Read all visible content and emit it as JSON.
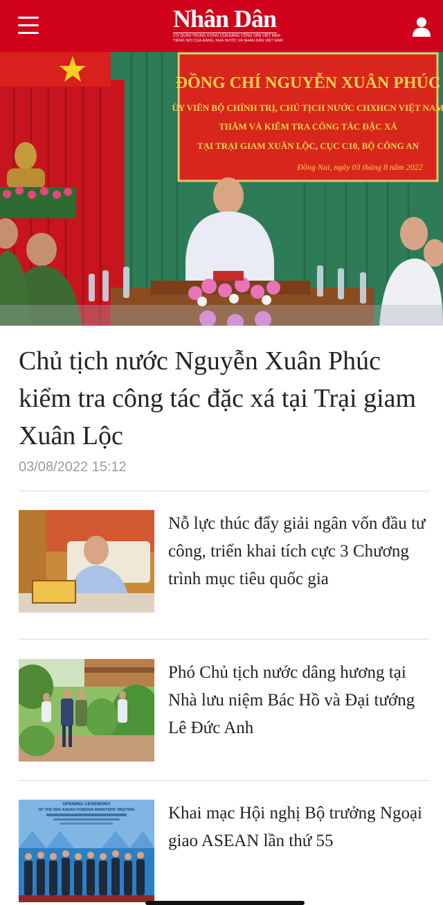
{
  "header": {
    "logo": "Nhân Dân",
    "logo_tagline_1": "CƠ QUAN TRUNG ƯƠNG CỦA ĐẢNG CỘNG SẢN VIỆT NAM",
    "logo_tagline_2": "TIẾNG NÓI CỦA ĐẢNG, NHÀ NƯỚC VÀ NHÂN DÂN VIỆT NAM",
    "menu_icon": "hamburger-menu-icon",
    "user_icon": "user-account-icon"
  },
  "hero": {
    "banner_line_1": "ĐỒNG CHÍ NGUYỄN XUÂN PHÚC",
    "banner_line_2": "ỦY VIÊN BỘ CHÍNH TRỊ, CHỦ TỊCH NƯỚC CHXHCN VIỆT NAM",
    "banner_line_3": "THĂM VÀ KIỂM TRA CÔNG TÁC ĐẶC XÁ",
    "banner_line_4": "TẠI TRẠI GIAM XUÂN LỘC, CỤC C10, BỘ CÔNG AN",
    "banner_date": "Đồng Nai, ngày 03 tháng 8 năm 2022",
    "title": "Chủ tịch nước Nguyễn Xuân Phúc kiểm tra công tác đặc xá tại Trại giam Xuân Lộc",
    "date": "03/08/2022 15:12"
  },
  "articles": [
    {
      "title": "Nỗ lực thúc đẩy giải ngân vốn đầu tư công, triển khai tích cực 3 Chương trình mục tiêu quốc gia"
    },
    {
      "title": "Phó Chủ tịch nước dâng hương tại Nhà lưu niệm Bác Hồ và Đại tướng Lê Đức Anh"
    },
    {
      "title": "Khai mạc Hội nghị Bộ trưởng Ngoại giao ASEAN lần thứ 55",
      "thumb_text_1": "OPENING CEREMONY",
      "thumb_text_2": "OF THE 55th ASEAN FOREIGN MINISTERS' MEETING"
    }
  ],
  "colors": {
    "brand_red": "#d0021b",
    "date_gray": "#9a9a9a",
    "divider": "#dddddd"
  }
}
